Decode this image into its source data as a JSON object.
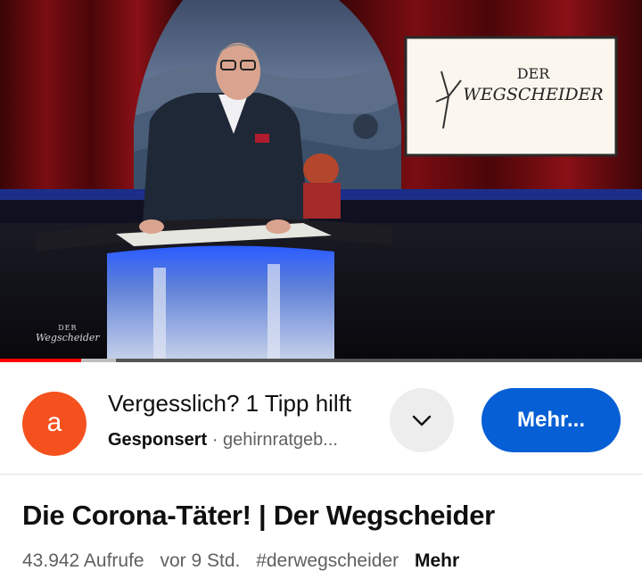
{
  "player": {
    "watermark_small": "DER",
    "watermark_big": "Wegscheider",
    "screen_title_small": "DER",
    "screen_title_big": "WEGSCHEIDER",
    "progress_played_fraction": 0.127,
    "progress_buffered_fraction": 0.18
  },
  "ad": {
    "avatar_letter": "a",
    "title": "Vergesslich? 1 Tipp hilft",
    "sponsored_label": "Gesponsert",
    "separator": "·",
    "advertiser": "gehirnratgeb...",
    "cta_label": "Mehr...",
    "avatar_color": "#f4511e",
    "cta_color": "#065fd4",
    "chevron_icon": "chevron-down-icon"
  },
  "video": {
    "title": "Die Corona-Täter! | Der Wegscheider",
    "views": "43.942 Aufrufe",
    "age": "vor 9 Std.",
    "hashtag": "#derwegscheider",
    "more_label": "Mehr"
  }
}
